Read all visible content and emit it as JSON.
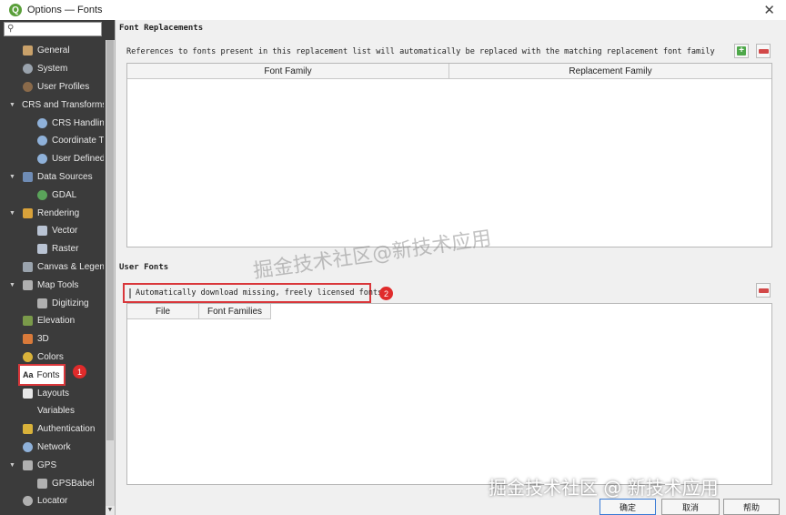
{
  "window": {
    "title": "Options — Fonts",
    "app_icon": "Q"
  },
  "sidebar": {
    "search": {
      "placeholder": ""
    },
    "items": [
      {
        "label": "General",
        "icon": "wrench-icon",
        "color": "#c9a16a"
      },
      {
        "label": "System",
        "icon": "gear-icon",
        "color": "#9aa3ad"
      },
      {
        "label": "User Profiles",
        "icon": "user-icon",
        "color": "#8a6a4a"
      },
      {
        "label": "CRS and Transforms",
        "icon": "",
        "color": ""
      },
      {
        "label": "CRS Handling",
        "icon": "globe-icon",
        "color": "#8fb1d9"
      },
      {
        "label": "Coordinate Transforms",
        "icon": "globe-icon",
        "color": "#8fb1d9"
      },
      {
        "label": "User Defined CRS",
        "icon": "globe-icon",
        "color": "#8fb1d9"
      },
      {
        "label": "Data Sources",
        "icon": "table-icon",
        "color": "#6f8cb5"
      },
      {
        "label": "GDAL",
        "icon": "globe-icon",
        "color": "#5aa35a"
      },
      {
        "label": "Rendering",
        "icon": "brush-icon",
        "color": "#d9a23a"
      },
      {
        "label": "Vector",
        "icon": "vector-icon",
        "color": "#b9c3d3"
      },
      {
        "label": "Raster",
        "icon": "raster-icon",
        "color": "#b9c3d3"
      },
      {
        "label": "Canvas & Legend",
        "icon": "canvas-icon",
        "color": "#9aa3ad"
      },
      {
        "label": "Map Tools",
        "icon": "ruler-icon",
        "color": "#b0b0b0"
      },
      {
        "label": "Digitizing",
        "icon": "pencil-icon",
        "color": "#b0b0b0"
      },
      {
        "label": "Elevation",
        "icon": "mountain-icon",
        "color": "#7a9a4a"
      },
      {
        "label": "3D",
        "icon": "cube-icon",
        "color": "#d97a3a"
      },
      {
        "label": "Colors",
        "icon": "palette-icon",
        "color": "#d9b23a"
      },
      {
        "label": "Fonts",
        "icon": "font-icon",
        "color": ""
      },
      {
        "label": "Layouts",
        "icon": "page-icon",
        "color": "#e8e8e8"
      },
      {
        "label": "Variables",
        "icon": "",
        "color": ""
      },
      {
        "label": "Authentication",
        "icon": "lock-icon",
        "color": "#d9b23a"
      },
      {
        "label": "Network",
        "icon": "network-icon",
        "color": "#8fb1d9"
      },
      {
        "label": "GPS",
        "icon": "satellite-icon",
        "color": "#b0b0b0"
      },
      {
        "label": "GPSBabel",
        "icon": "satellite-icon",
        "color": "#b0b0b0"
      },
      {
        "label": "Locator",
        "icon": "search-icon",
        "color": "#b0b0b0"
      }
    ],
    "selected_badge": "1"
  },
  "font_replacements": {
    "title": "Font Replacements",
    "description": "References to fonts present in this replacement list will automatically be replaced with the matching replacement font family",
    "columns": [
      "Font Family",
      "Replacement Family"
    ]
  },
  "user_fonts": {
    "title": "User Fonts",
    "checkbox_label": "Automatically download missing, freely licensed fonts",
    "checkbox_checked": false,
    "badge": "2",
    "columns": [
      "File",
      "Font Families"
    ]
  },
  "watermark": "掘金技术社区@新技术应用",
  "footer_watermark": "掘金技术社区 @ 新技术应用",
  "buttons": {
    "ok": "确定",
    "cancel": "取消",
    "help": "帮助"
  },
  "colors": {
    "sidebar_bg": "#3b3b3b",
    "highlight_red": "#d9373b",
    "add_green": "#4ea84a",
    "remove_red": "#d24848"
  }
}
